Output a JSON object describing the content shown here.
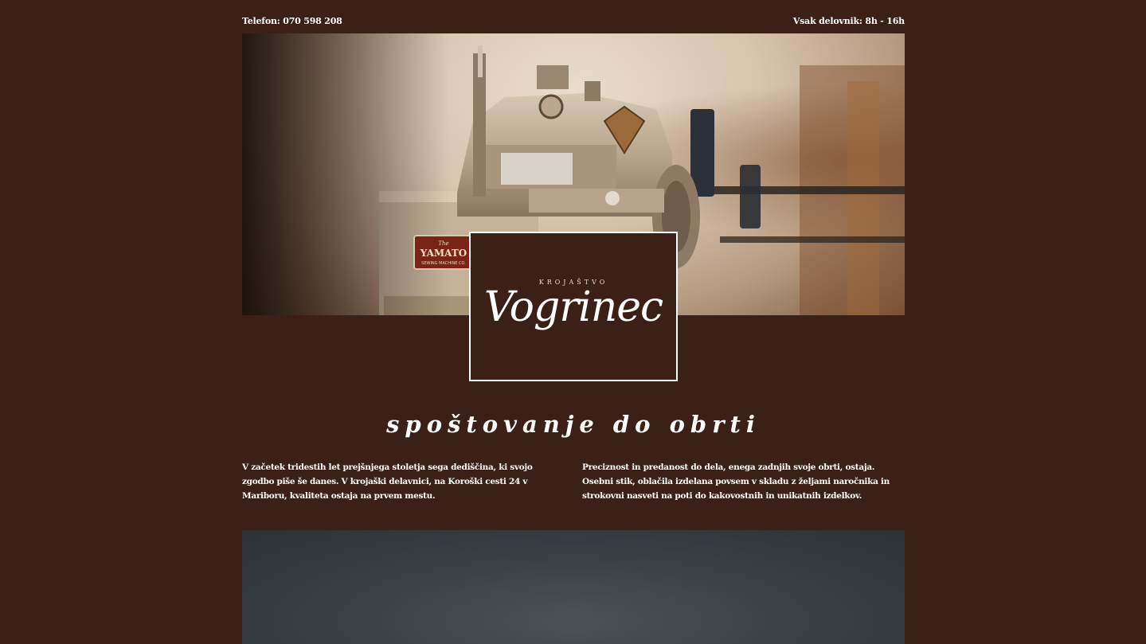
{
  "topbar": {
    "phone": "Telefon: 070 598 208",
    "hours": "Vsak delovnik: 8h - 16h"
  },
  "hero": {
    "machine_brand": "YAMATO",
    "machine_brand_small": "The",
    "machine_subtitle": "SEWING MACHINE CO."
  },
  "logo": {
    "small": "KROJAŠTVO",
    "big": "Vogrinec"
  },
  "tagline": "spoštovanje do obrti",
  "intro": {
    "left": "V začetek tridestih let prejšnjega stoletja sega dediščina, ki svojo zgodbo piše še danes. V krojaški delavnici, na Koroški cesti 24 v Mariboru, kvaliteta ostaja na prvem mestu.",
    "right": "Preciznost in predanost do dela, enega zadnjih svoje obrti, ostaja. Osebni stik, oblačila izdelana povsem v skladu z željami naročnika in strokovni nasveti na poti do kakovostnih in unikatnih izdelkov."
  },
  "colors": {
    "background": "#3a2017",
    "text": "#ffffff"
  }
}
